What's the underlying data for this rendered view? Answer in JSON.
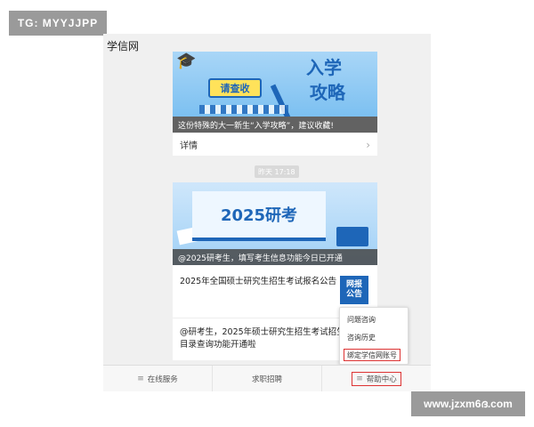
{
  "watermarks": {
    "top_left": "TG: MYYJJPP",
    "bottom_right": "www.jzxm6ദ.com"
  },
  "header": {
    "title": "学信网",
    "close_glyph": "✕"
  },
  "card1": {
    "banner_tag": "请查收",
    "banner_big_line1": "入学",
    "banner_big_line2": "攻略",
    "caption": "这份特殊的大一新生“入学攻略”，建议收藏!",
    "detail_label": "详情",
    "chevron": "›"
  },
  "time_label": "昨天 17:18",
  "card2": {
    "banner_text": "2025研考",
    "caption": "@2025研考生，填写考生信息功能今日已开通",
    "article1_title": "2025年全国硕士研究生招生考试报名公告",
    "thumb_line1": "网报",
    "thumb_line2": "公告",
    "article2_title": "@研考生，2025年硕士研究生招生考试招生专业目录查询功能开通啦"
  },
  "popup_menu": {
    "items": [
      "问题咨询",
      "咨询历史",
      "绑定学信网账号"
    ]
  },
  "tabbar": {
    "tab1": "在线服务",
    "tab2": "求职招聘",
    "tab3": "帮助中心",
    "menu_glyph": "≡"
  }
}
